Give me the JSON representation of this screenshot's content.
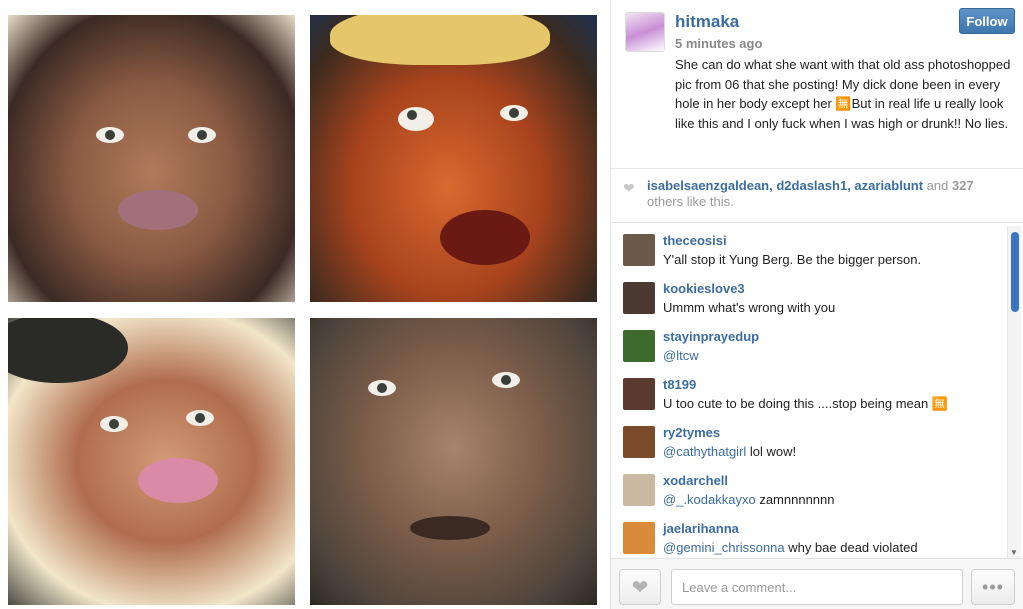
{
  "post": {
    "username": "hitmaka",
    "time_ago": "5 minutes ago",
    "follow_label": "Follow",
    "caption": "She can do what she want with that old ass photoshopped pic from 06 that she posting! My dick done been in every hole in her body except her 🈚But in real life u really look like this and I only fuck when I was high or drunk!! No lies."
  },
  "likes": {
    "users": [
      "isabelsaenzgaldean",
      "d2daslash1",
      "azariablunt"
    ],
    "sep1": ", ",
    "sep2": ", ",
    "and_text": " and ",
    "count": "327",
    "suffix": " others like this."
  },
  "comments": [
    {
      "user": "theceosisi",
      "mention": "",
      "text": "Y'all stop it Yung Berg. Be the bigger person.",
      "avatar_color": "#6b5a4a"
    },
    {
      "user": "kookieslove3",
      "mention": "",
      "text": "Ummm what's wrong with you",
      "avatar_color": "#4a3a32"
    },
    {
      "user": "stayinprayedup",
      "mention": "@ltcw",
      "text": "",
      "avatar_color": "#3d6b2e"
    },
    {
      "user": "t8199",
      "mention": "",
      "text": "U too cute to be doing this ....stop being mean 🈚",
      "avatar_color": "#5a3a2e"
    },
    {
      "user": "ry2tymes",
      "mention": "@cathythatgirl",
      "text": " lol wow!",
      "avatar_color": "#7a4a2a"
    },
    {
      "user": "xodarchell",
      "mention": "@_.kodakkayxo",
      "text": " zamnnnnnnn",
      "avatar_color": "#c9b9a0"
    },
    {
      "user": "jaelarihanna",
      "mention": "@gemini_chrissonna",
      "text": " why bae dead violated",
      "avatar_color": "#d98a3a"
    }
  ],
  "input": {
    "placeholder": "Leave a comment..."
  },
  "more_label": "•••",
  "icons": {
    "like": "heart-icon",
    "more": "more-icon"
  },
  "colors": {
    "link": "#3b6da0",
    "follow_button": "#4a82bb",
    "scroll_thumb": "#3b74c4"
  }
}
